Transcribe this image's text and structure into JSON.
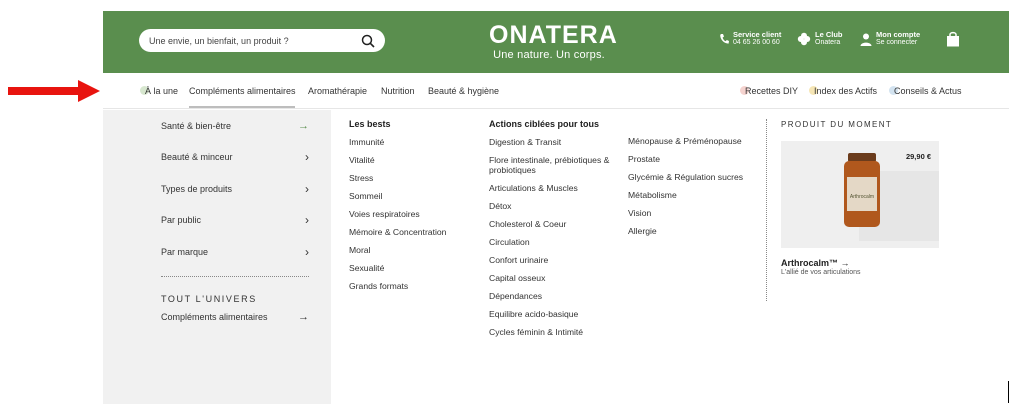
{
  "header": {
    "search_placeholder": "Une envie, un bienfait, un produit ?",
    "logo": "ONATERA",
    "tagline": "Une nature. Un corps.",
    "service_title": "Service client",
    "service_phone": "04 65 26 00 60",
    "club_title": "Le Club",
    "club_sub": "Onatera",
    "account_title": "Mon compte",
    "account_sub": "Se connecter"
  },
  "nav": {
    "items": [
      "À la une",
      "Compléments alimentaires",
      "Aromathérapie",
      "Nutrition",
      "Beauté & hygiène"
    ],
    "right_items": [
      "Recettes DIY",
      "Index des Actifs",
      "Conseils & Actus"
    ]
  },
  "sidebar": {
    "items": [
      "Santé & bien-être",
      "Beauté & minceur",
      "Types de produits",
      "Par public",
      "Par marque"
    ],
    "arrow": "→",
    "chevron": "›",
    "universe_heading": "TOUT L'UNIVERS",
    "universe_link": "Compléments alimentaires"
  },
  "bests": {
    "title": "Les bests",
    "items": [
      "Immunité",
      "Vitalité",
      "Stress",
      "Sommeil",
      "Voies respiratoires",
      "Mémoire & Concentration",
      "Moral",
      "Sexualité",
      "Grands formats"
    ]
  },
  "actions": {
    "title": "Actions ciblées pour tous",
    "col1": [
      "Digestion & Transit",
      "Flore intestinale, prébiotiques & probiotiques",
      "Articulations & Muscles",
      "Détox",
      "Cholesterol & Coeur",
      "Circulation",
      "Confort urinaire",
      "Capital osseux",
      "Dépendances",
      "Equilibre acido-basique",
      "Cycles féminin & Intimité"
    ],
    "col2": [
      "Ménopause & Préménopause",
      "Prostate",
      "Glycémie & Régulation sucres",
      "Métabolisme",
      "Vision",
      "Allergie"
    ]
  },
  "product": {
    "heading": "PRODUIT DU MOMENT",
    "price": "29,90 €",
    "name": "Arthrocalm™",
    "arrow": "→",
    "desc": "L'allié de vos articulations",
    "jar_label": "Arthrocalm"
  },
  "colors": {
    "header_green": "#5a8e4e",
    "sidebar_bg": "#f1f1f1",
    "arrow_red": "#e8140f"
  }
}
